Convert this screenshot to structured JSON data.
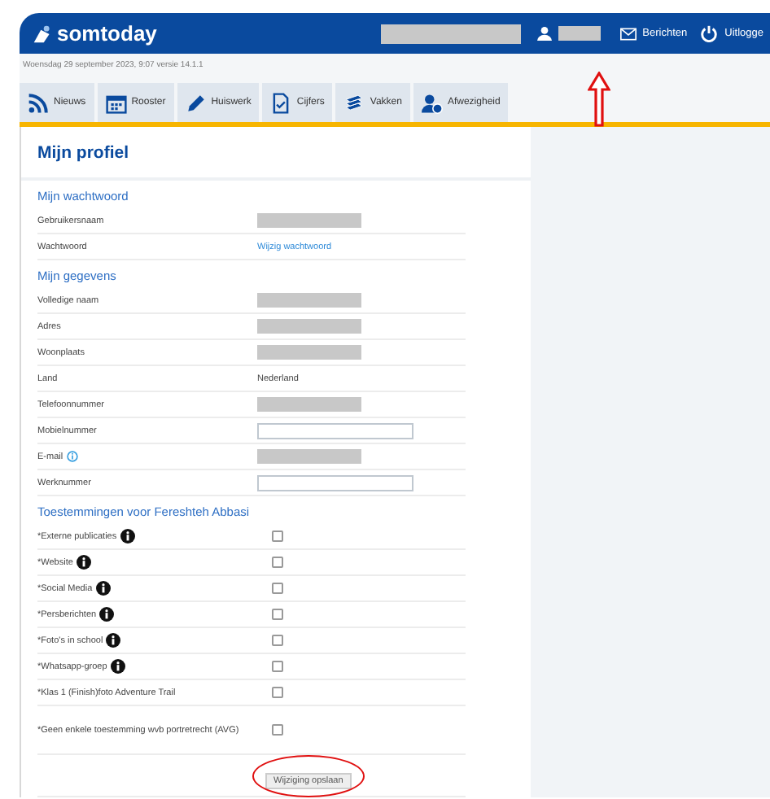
{
  "header": {
    "logo": "somtoday",
    "messages": "Berichten",
    "logout": "Uitlogge"
  },
  "date_line": "Woensdag 29 september 2023, 9:07 versie 14.1.1",
  "tabs": [
    {
      "label": "Nieuws",
      "selected": false
    },
    {
      "label": "Rooster",
      "selected": false
    },
    {
      "label": "Huiswerk",
      "selected": false
    },
    {
      "label": "Cijfers",
      "selected": false
    },
    {
      "label": "Vakken",
      "selected": false
    },
    {
      "label": "Afwezigheid",
      "selected": false
    }
  ],
  "page_title": "Mijn profiel",
  "sections": [
    {
      "title": "Mijn wachtwoord",
      "rows": [
        {
          "label": "Gebruikersnaam",
          "kind": "redacted",
          "info": false
        },
        {
          "label": "Wachtwoord",
          "kind": "link",
          "value": "Wijzig wachtwoord",
          "info": false
        }
      ]
    },
    {
      "title": "Mijn gegevens",
      "rows": [
        {
          "label": "Volledige naam",
          "kind": "redacted",
          "info": false
        },
        {
          "label": "Adres",
          "kind": "redacted",
          "info": false
        },
        {
          "label": "Woonplaats",
          "kind": "redacted",
          "info": false
        },
        {
          "label": "Land",
          "kind": "text",
          "value": "Nederland",
          "info": false
        },
        {
          "label": "Telefoonnummer",
          "kind": "redacted",
          "info": false
        },
        {
          "label": "Mobielnummer",
          "kind": "input",
          "info": false
        },
        {
          "label": "E-mail",
          "kind": "redacted",
          "info": true
        },
        {
          "label": "Werknummer",
          "kind": "input",
          "info": false
        }
      ]
    },
    {
      "title": "Toestemmingen voor Fereshteh Abbasi",
      "rows": [
        {
          "label": "*Externe publicaties",
          "kind": "checkbox",
          "checked": false,
          "info": true
        },
        {
          "label": "*Website",
          "kind": "checkbox",
          "checked": false,
          "info": true
        },
        {
          "label": "*Social Media",
          "kind": "checkbox",
          "checked": false,
          "info": true
        },
        {
          "label": "*Persberichten",
          "kind": "checkbox",
          "checked": false,
          "info": true
        },
        {
          "label": "*Foto's in school",
          "kind": "checkbox",
          "checked": false,
          "info": true
        },
        {
          "label": "*Whatsapp-groep",
          "kind": "checkbox",
          "checked": false,
          "info": true
        },
        {
          "label": "*Klas 1 (Finish)foto Adventure Trail",
          "kind": "checkbox",
          "checked": false,
          "info": false
        },
        {
          "label": "*Geen enkele toestemming wvb portretrecht (AVG)",
          "kind": "checkbox",
          "checked": false,
          "info": false
        }
      ]
    }
  ],
  "save_button": "Wijziging opslaan"
}
